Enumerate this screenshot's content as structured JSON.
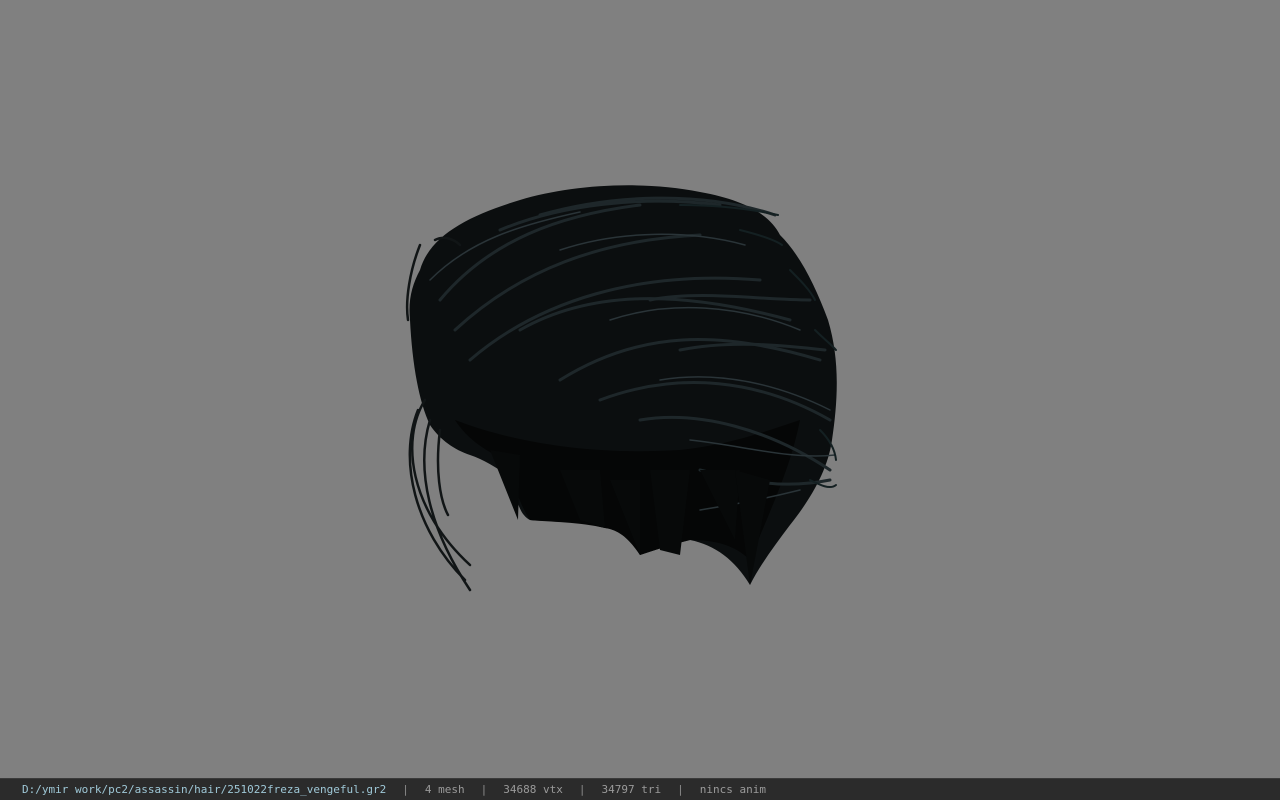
{
  "viewer": {
    "background_color": "#808080",
    "model_color": "#0b0e0f",
    "model_highlight_color": "#2a3438"
  },
  "status_bar": {
    "file_path": "D:/ymir work/pc2/assassin/hair/251022freza_vengeful.gr2",
    "separator": "|",
    "mesh_count": "4 mesh",
    "vertex_count": "34688 vtx",
    "triangle_count": "34797 tri",
    "animation_status": "nincs anim"
  }
}
